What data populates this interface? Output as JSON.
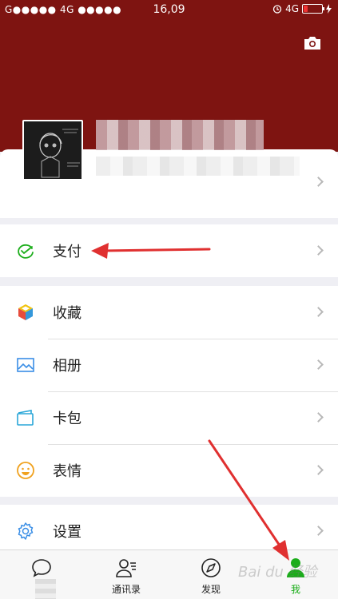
{
  "status_bar": {
    "carrier": "G●●●●● 4G ●●●●●",
    "time": "16,09",
    "network": "4G"
  },
  "menu": {
    "pay_label": "支付",
    "favorites_label": "收藏",
    "album_label": "相册",
    "cards_label": "卡包",
    "stickers_label": "表情",
    "settings_label": "设置"
  },
  "tabbar": {
    "contacts_label": "通讯录",
    "discover_label": "发现",
    "me_label": "我"
  },
  "colors": {
    "header": "#7e1411",
    "accent_green": "#1aad19",
    "annotation_red": "#e03030"
  },
  "watermark": "Bai du 经验"
}
